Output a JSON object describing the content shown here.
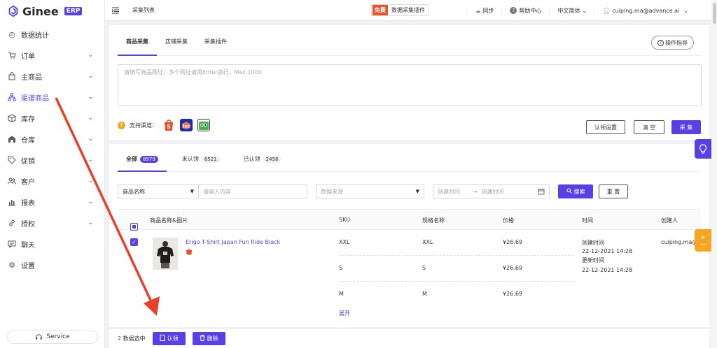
{
  "brand": {
    "name": "Ginee",
    "badge": "ERP"
  },
  "sidebar": {
    "items": [
      {
        "label": "数据统计",
        "icon": "dashboard-icon",
        "chevron": false
      },
      {
        "label": "订单",
        "icon": "cart-icon",
        "chevron": true
      },
      {
        "label": "主商品",
        "icon": "bag-icon",
        "chevron": true
      },
      {
        "label": "渠道商品",
        "icon": "sitemap-icon",
        "chevron": true,
        "active": true
      },
      {
        "label": "库存",
        "icon": "box-icon",
        "chevron": true
      },
      {
        "label": "仓库",
        "icon": "warehouse-icon",
        "chevron": true
      },
      {
        "label": "促销",
        "icon": "tag-icon",
        "chevron": true
      },
      {
        "label": "客户",
        "icon": "users-icon",
        "chevron": true
      },
      {
        "label": "报表",
        "icon": "bar-chart-icon",
        "chevron": true
      },
      {
        "label": "授权",
        "icon": "link-icon",
        "chevron": true
      },
      {
        "label": "聊天",
        "icon": "chat-icon",
        "chevron": false
      },
      {
        "label": "设置",
        "icon": "gear-icon",
        "chevron": false
      }
    ],
    "service_label": "Service"
  },
  "topbar": {
    "page_title": "采集列表",
    "free_tag": "免费",
    "plugin_label": "数据采集插件",
    "sync": "同步",
    "help": "帮助中心",
    "language": "中文简体",
    "user": "cuiping.ma@advance.ai"
  },
  "collect": {
    "tabs": [
      "商品采集",
      "店铺采集",
      "采集插件"
    ],
    "guide_label": "操作指导",
    "url_placeholder": "请填写商品网址，多个网址请用Enter换行，Max.1000",
    "support_label": "支持渠道：",
    "channels": [
      "shopee",
      "lazada",
      "tokopedia"
    ],
    "btn_claim_settings": "认领设置",
    "btn_clear": "清 空",
    "btn_collect": "采 集"
  },
  "list": {
    "tabs": [
      {
        "label": "全部",
        "count": "8979"
      },
      {
        "label": "未认领",
        "count": "6521"
      },
      {
        "label": "已认领",
        "count": "2458"
      }
    ],
    "filter": {
      "field_select": "商品名称",
      "search_placeholder": "请输入内容",
      "source_placeholder": "数据来源",
      "date_start": "创建时间",
      "date_arrow": "→",
      "date_end": "创建时间",
      "search_btn": "搜索",
      "reset_btn": "重 置"
    },
    "columns": [
      "商品名称&图片",
      "SKU",
      "规格名称",
      "价格",
      "时间",
      "创建人"
    ],
    "product": {
      "name": "Erigo T-Shirt Japan Fun Ride Black",
      "variants": [
        {
          "sku": "XXL",
          "spec": "XXL",
          "price": "¥26.69"
        },
        {
          "sku": "S",
          "spec": "S",
          "price": "¥26.69"
        },
        {
          "sku": "M",
          "spec": "M",
          "price": "¥26.69"
        }
      ],
      "expand": "展开",
      "created_label": "创建时间",
      "created": "22-12-2021 14:28",
      "updated_label": "更新时间",
      "updated": "22-12-2021 14:28",
      "creator": "cuiping.ma@"
    }
  },
  "bottom": {
    "selected_count": "2",
    "selected_text": "数据选中",
    "claim_btn": "认领",
    "delete_btn": "删除"
  },
  "colors": {
    "accent": "#5b3fe6",
    "arrow": "#e8402a",
    "warning": "#f5a623"
  }
}
